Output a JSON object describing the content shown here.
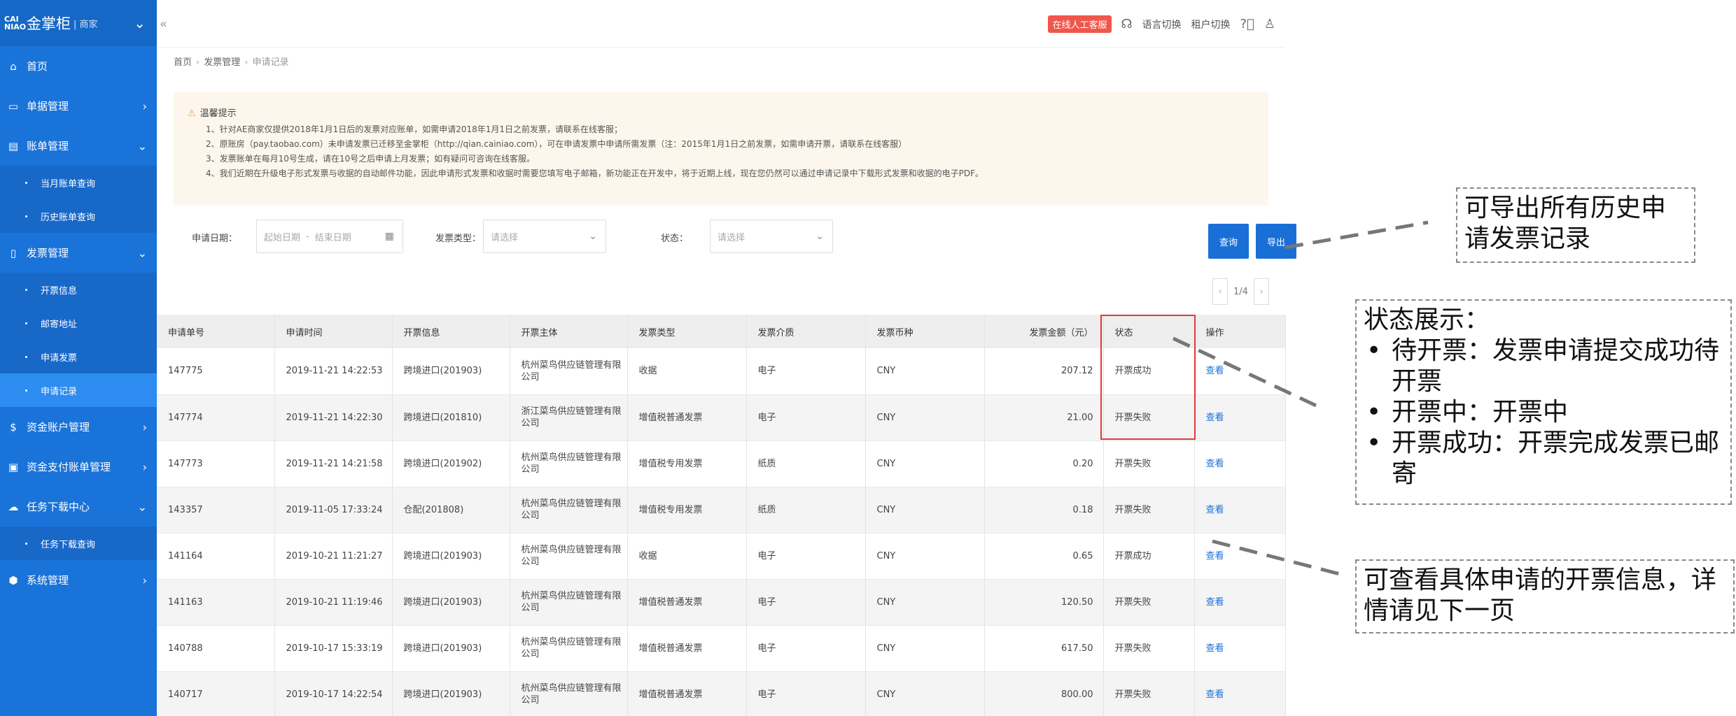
{
  "app": {
    "logo_mark": "CAI NIAO",
    "title": "金掌柜",
    "subtitle": "| 商家"
  },
  "sidebar": {
    "items": [
      {
        "label": "首页",
        "icon": "home-icon",
        "glyph": "⌂"
      },
      {
        "label": "单据管理",
        "icon": "document-icon",
        "glyph": "▭"
      },
      {
        "label": "账单管理",
        "icon": "bill-icon",
        "glyph": "▤",
        "children": [
          "当月账单查询",
          "历史账单查询"
        ]
      },
      {
        "label": "发票管理",
        "icon": "invoice-icon",
        "glyph": "▯",
        "children": [
          "开票信息",
          "邮寄地址",
          "申请发票",
          "申请记录"
        ]
      },
      {
        "label": "资金账户管理",
        "icon": "dollar-icon",
        "glyph": "$"
      },
      {
        "label": "资金支付账单管理",
        "icon": "payment-icon",
        "glyph": "▣"
      },
      {
        "label": "任务下载中心",
        "icon": "cloud-download-icon",
        "glyph": "☁",
        "children": [
          "任务下载查询"
        ]
      },
      {
        "label": "系统管理",
        "icon": "settings-icon",
        "glyph": "⬢"
      }
    ]
  },
  "topbar": {
    "chat_label": "在线人工客服",
    "language_label": "语言切换",
    "tenant_label": "租户切换"
  },
  "breadcrumb": [
    "首页",
    "发票管理",
    "申请记录"
  ],
  "notice": {
    "title": "温馨提示",
    "lines": [
      "1、针对AE商家仅提供2018年1月1日后的发票对应账单，如需申请2018年1月1日之前发票，请联系在线客服；",
      "2、原账房（pay.taobao.com）未申请发票已迁移至金掌柜（http://qian.cainiao.com），可在申请发票中申请所需发票（注：2015年1月1日之前发票，如需申请开票，请联系在线客服）",
      "3、发票账单在每月10号生成，请在10号之后申请上月发票；如有疑问可咨询在线客服。",
      "4、我们近期在升级电子形式发票与收据的自动邮件功能，因此申请形式发票和收据时需要您填写电子邮箱，新功能正在开发中，将于近期上线，现在您仍然可以通过申请记录中下载形式发票和收据的电子PDF。"
    ]
  },
  "filters": {
    "date_label": "申请日期：",
    "date_start_placeholder": "起始日期",
    "date_sep": "-",
    "date_end_placeholder": "结束日期",
    "type_label": "发票类型：",
    "type_placeholder": "请选择",
    "status_label": "状态：",
    "status_placeholder": "请选择",
    "query_label": "查询",
    "export_label": "导出"
  },
  "pager": {
    "text": "1/4"
  },
  "table": {
    "columns": [
      "申请单号",
      "申请时间",
      "开票信息",
      "开票主体",
      "发票类型",
      "发票介质",
      "发票币种",
      "发票金额（元）",
      "状态",
      "操作"
    ],
    "rows": [
      [
        "147775",
        "2019-11-21 14:22:53",
        "跨境进口(201903)",
        "杭州菜鸟供应链管理有限公司",
        "收据",
        "电子",
        "CNY",
        "207.12",
        "开票成功",
        "查看"
      ],
      [
        "147774",
        "2019-11-21 14:22:30",
        "跨境进口(201810)",
        "浙江菜鸟供应链管理有限公司",
        "增值税普通发票",
        "电子",
        "CNY",
        "21.00",
        "开票失败",
        "查看"
      ],
      [
        "147773",
        "2019-11-21 14:21:58",
        "跨境进口(201902)",
        "杭州菜鸟供应链管理有限公司",
        "增值税专用发票",
        "纸质",
        "CNY",
        "0.20",
        "开票失败",
        "查看"
      ],
      [
        "143357",
        "2019-11-05 17:33:24",
        "仓配(201808)",
        "杭州菜鸟供应链管理有限公司",
        "增值税专用发票",
        "纸质",
        "CNY",
        "0.18",
        "开票失败",
        "查看"
      ],
      [
        "141164",
        "2019-10-21 11:21:27",
        "跨境进口(201903)",
        "杭州菜鸟供应链管理有限公司",
        "收据",
        "电子",
        "CNY",
        "0.65",
        "开票成功",
        "查看"
      ],
      [
        "141163",
        "2019-10-21 11:19:46",
        "跨境进口(201903)",
        "杭州菜鸟供应链管理有限公司",
        "增值税普通发票",
        "电子",
        "CNY",
        "120.50",
        "开票失败",
        "查看"
      ],
      [
        "140788",
        "2019-10-17 15:33:19",
        "跨境进口(201903)",
        "杭州菜鸟供应链管理有限公司",
        "增值税普通发票",
        "电子",
        "CNY",
        "617.50",
        "开票失败",
        "查看"
      ],
      [
        "140717",
        "2019-10-17 14:22:54",
        "跨境进口(201903)",
        "杭州菜鸟供应链管理有限公司",
        "增值税普通发票",
        "电子",
        "CNY",
        "800.00",
        "开票失败",
        "查看"
      ]
    ]
  },
  "annotations": {
    "export_note": "可导出所有历史申请发票记录",
    "status_title": "状态展示：",
    "status_items": [
      "待开票：发票申请提交成功待开票",
      "开票中：开票中",
      "开票成功：开票完成发票已邮寄"
    ],
    "view_note": "可查看具体申请的开票信息，详情请见下一页"
  },
  "colors": {
    "sidebar": "#1a73d9",
    "accent": "#1a6fd6",
    "highlight": "#e53935",
    "notice_bg": "#fdf6ec"
  }
}
